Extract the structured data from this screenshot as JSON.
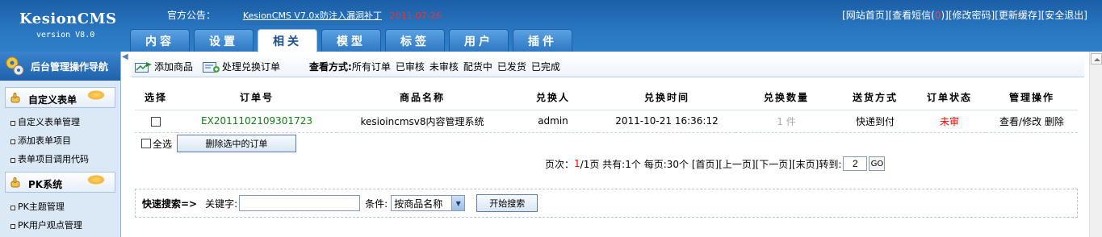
{
  "app": {
    "name": "KesionCMS",
    "version": "version V8.0"
  },
  "notice": {
    "label": "官方公告：",
    "text": "KesionCMS V7.0x防注入漏洞补丁",
    "date": "2011-07-26"
  },
  "top_links": [
    {
      "label": "[网站首页]"
    },
    {
      "label": "[查看短信(",
      "count": "0",
      "tail": ")]"
    },
    {
      "label": "[修改密码]"
    },
    {
      "label": "[更新缓存]"
    },
    {
      "label": "[安全退出]"
    }
  ],
  "tabs": [
    "内容",
    "设置",
    "相关",
    "模型",
    "标签",
    "用户",
    "插件"
  ],
  "active_tab": "相关",
  "sidebar": {
    "title": "后台管理操作导航",
    "sections": [
      {
        "title": "自定义表单",
        "items": [
          "自定义表单管理",
          "添加表单项目",
          "表单项目调用代码"
        ]
      },
      {
        "title": "PK系统",
        "items": [
          "PK主题管理",
          "PK用户观点管理"
        ]
      }
    ]
  },
  "toolbar": {
    "add": "添加商品",
    "process": "处理兑换订单",
    "view_label": "查看方式:",
    "filters": [
      "所有订单",
      "已审核",
      "未审核",
      "配货中",
      "已发货",
      "已完成"
    ]
  },
  "table": {
    "headers": [
      "选择",
      "订单号",
      "商品名称",
      "兑换人",
      "兑换时间",
      "兑换数量",
      "送货方式",
      "订单状态",
      "管理操作"
    ],
    "rows": [
      {
        "order_no": "EX2011102109301723",
        "product": "kesioincmsv8内容管理系统",
        "user": "admin",
        "time": "2011-10-21 16:36:12",
        "qty": "1 件",
        "delivery": "快递到付",
        "status": "未审",
        "action_edit": "查看/修改",
        "action_delete": "删除"
      }
    ]
  },
  "bulk": {
    "select_all": "全选",
    "delete_button": "删除选中的订单"
  },
  "pager": {
    "label": "页次：",
    "current": "1",
    "total": "/1页",
    "count": "共有:1个",
    "per_page": "每页:30个",
    "first": "[首页]",
    "prev": "[上一页]",
    "next": "[下一页]",
    "last": "[末页]",
    "goto_label": "转到:",
    "goto_value": "2",
    "go": "GO"
  },
  "search": {
    "title": "快速搜索=>",
    "keyword_label": "关键字:",
    "keyword_value": "",
    "condition_label": "条件:",
    "condition_value": "按商品名称",
    "button": "开始搜索"
  },
  "colors": {
    "header": "#2a77c2",
    "order_no": "#1a7a1a",
    "status": "#ff0000",
    "notice_date": "#ff2a2a"
  }
}
